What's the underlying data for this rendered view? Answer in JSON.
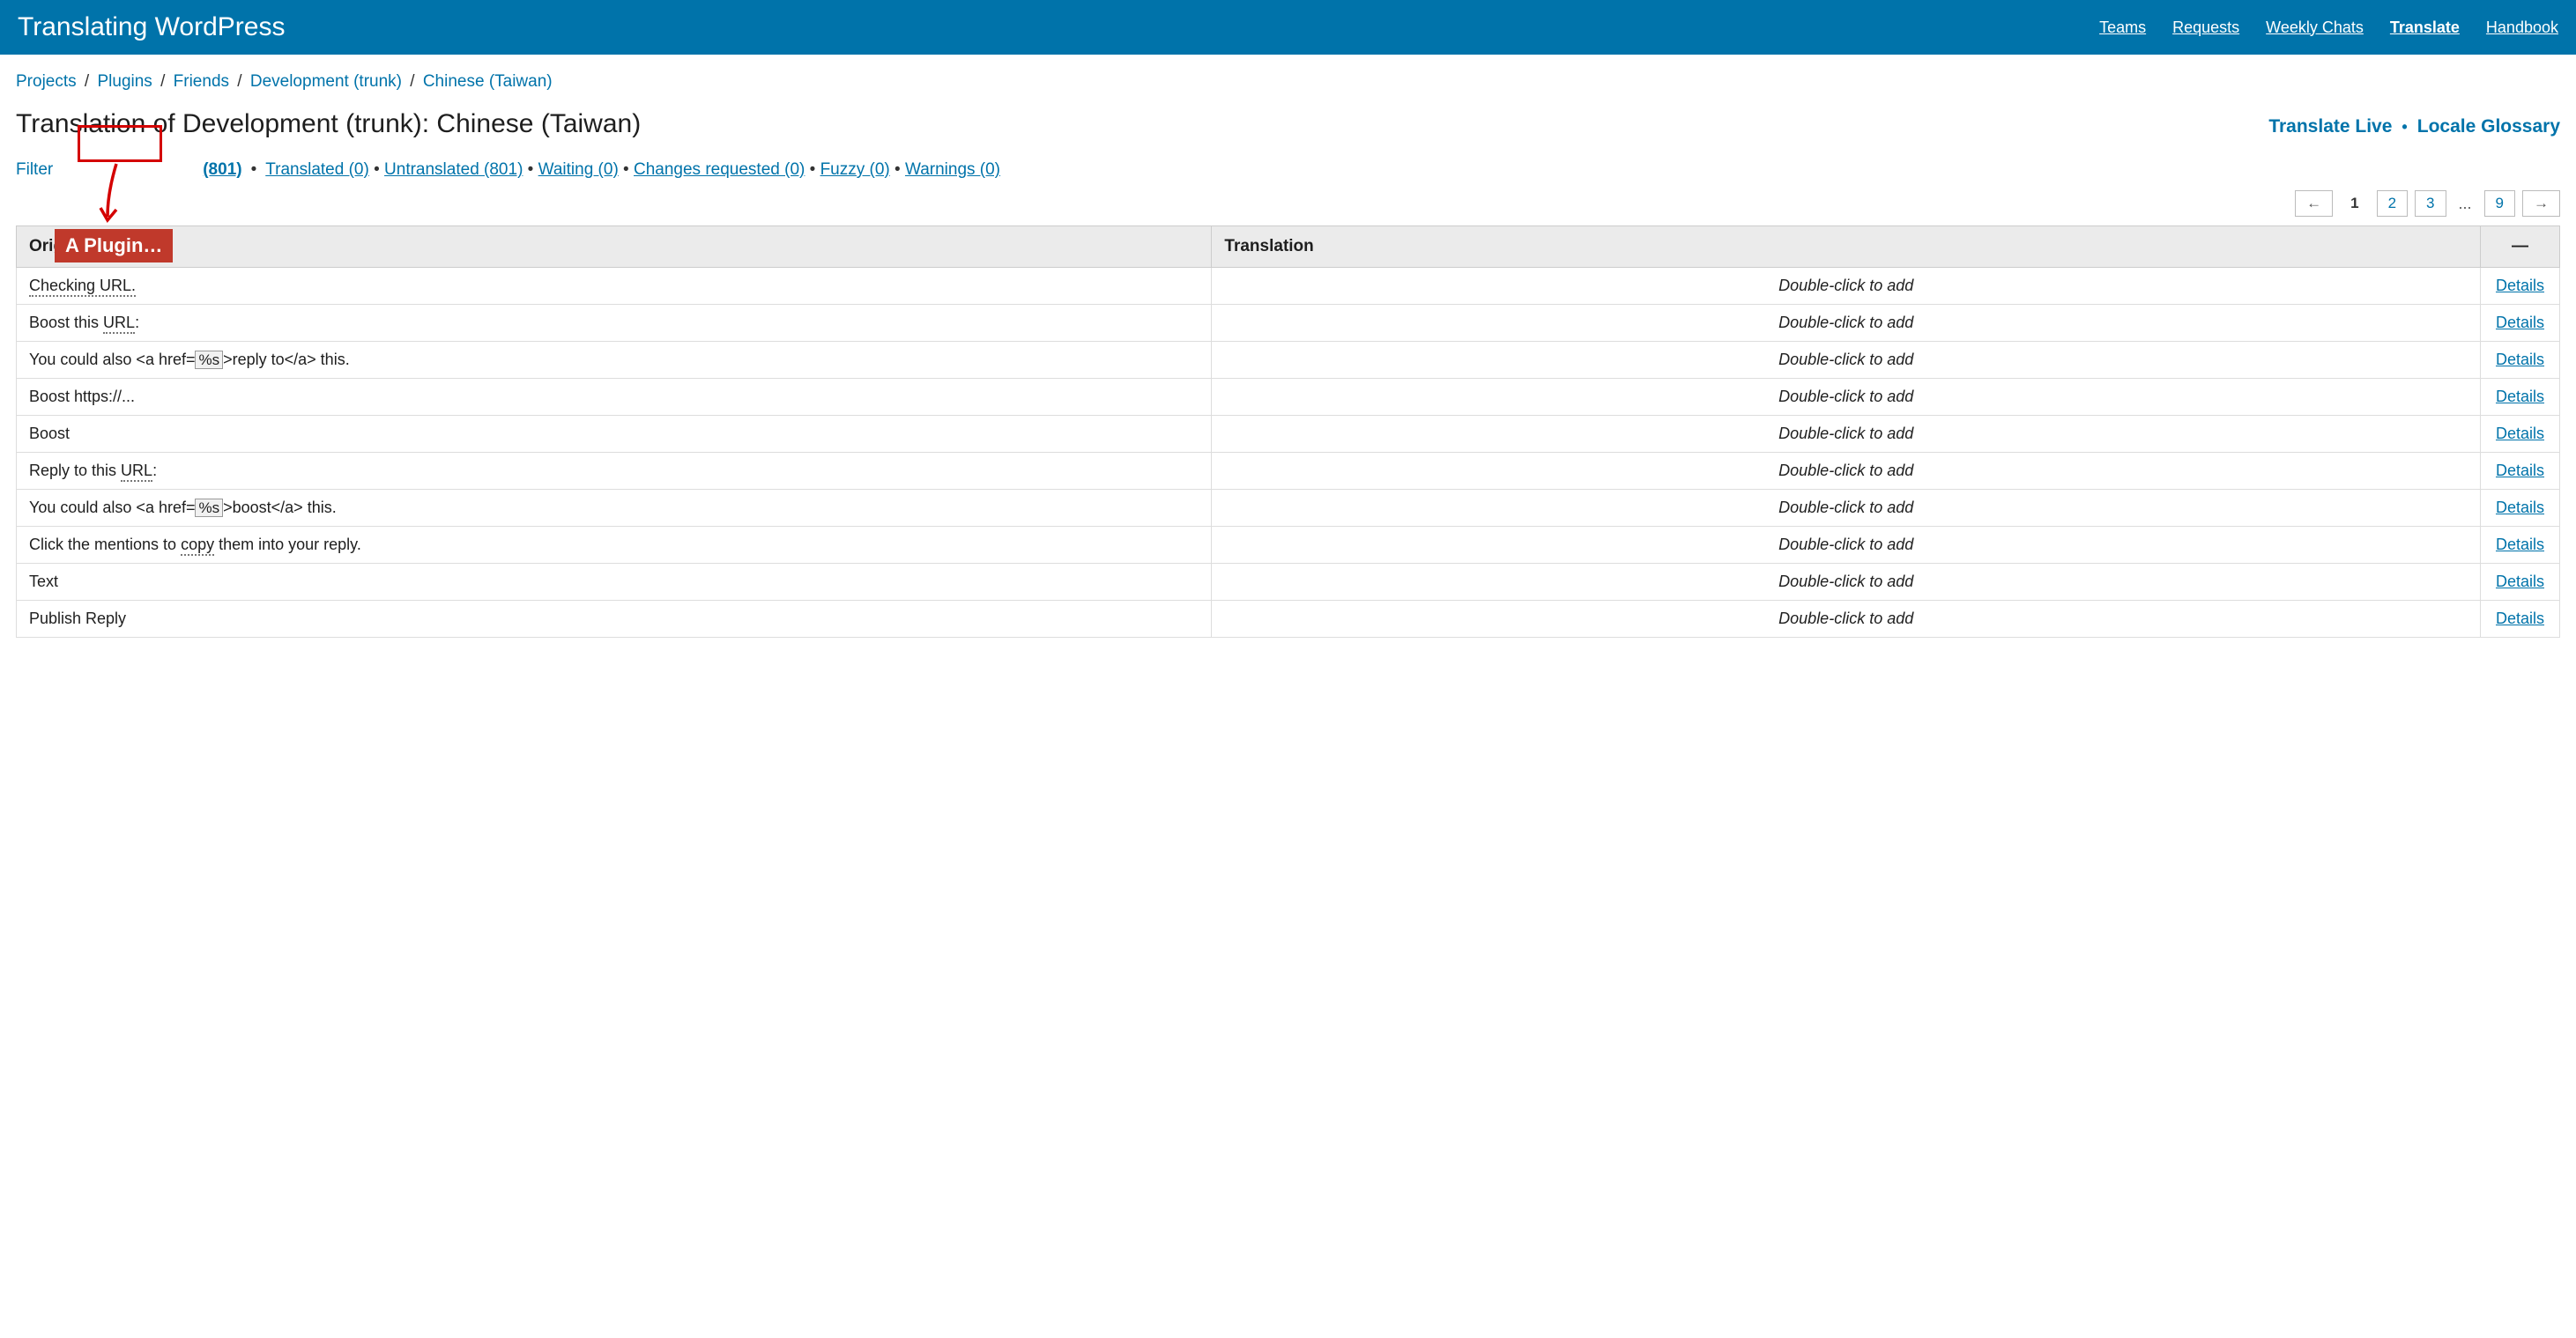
{
  "header": {
    "site_title": "Translating WordPress",
    "nav": [
      "Teams",
      "Requests",
      "Weekly Chats",
      "Translate",
      "Handbook"
    ],
    "active_nav_index": 3
  },
  "breadcrumb": {
    "items": [
      "Projects",
      "Plugins",
      "Friends",
      "Development (trunk)",
      "Chinese (Taiwan)"
    ]
  },
  "page": {
    "title": "Translation of Development (trunk): Chinese (Taiwan)",
    "right_link_1": "Translate Live",
    "right_link_2": "Locale Glossary"
  },
  "filters": {
    "filter_label": "Filter",
    "all_suffix": "(801)",
    "statuses": [
      "Translated (0)",
      "Untranslated (801)",
      "Waiting (0)",
      "Changes requested (0)",
      "Fuzzy (0)",
      "Warnings (0)"
    ]
  },
  "pagination": {
    "prev": "←",
    "pages": [
      "1",
      "2",
      "3"
    ],
    "ellipsis": "...",
    "last": "9",
    "next": "→",
    "current_index": 0
  },
  "table": {
    "col_original": "Original string",
    "col_translation": "Translation",
    "col_actions": "—",
    "placeholder": "Double-click to add",
    "details_label": "Details",
    "rows": [
      {
        "segments": [
          {
            "t": "Checking URL.",
            "d": true
          }
        ]
      },
      {
        "segments": [
          {
            "t": "Boost this ",
            "d": false
          },
          {
            "t": "URL",
            "d": true
          },
          {
            "t": ":",
            "d": false
          }
        ]
      },
      {
        "segments": [
          {
            "t": "You could also <a href=",
            "d": false
          },
          {
            "t": "%s",
            "code": true
          },
          {
            "t": ">reply to</a> this.",
            "d": false
          }
        ]
      },
      {
        "segments": [
          {
            "t": "Boost https://...",
            "d": false
          }
        ]
      },
      {
        "segments": [
          {
            "t": "Boost",
            "d": false
          }
        ]
      },
      {
        "segments": [
          {
            "t": "Reply to this ",
            "d": false
          },
          {
            "t": "URL",
            "d": true
          },
          {
            "t": ":",
            "d": false
          }
        ]
      },
      {
        "segments": [
          {
            "t": "You could also <a href=",
            "d": false
          },
          {
            "t": "%s",
            "code": true
          },
          {
            "t": ">boost</a> this.",
            "d": false
          }
        ]
      },
      {
        "segments": [
          {
            "t": "Click the mentions to ",
            "d": false
          },
          {
            "t": "copy",
            "d": true
          },
          {
            "t": " them into your reply.",
            "d": false
          }
        ]
      },
      {
        "segments": [
          {
            "t": "Text",
            "d": false
          }
        ]
      },
      {
        "segments": [
          {
            "t": "Publish Reply",
            "d": false
          }
        ]
      }
    ]
  },
  "annotation": {
    "label": "A Plugin…"
  }
}
